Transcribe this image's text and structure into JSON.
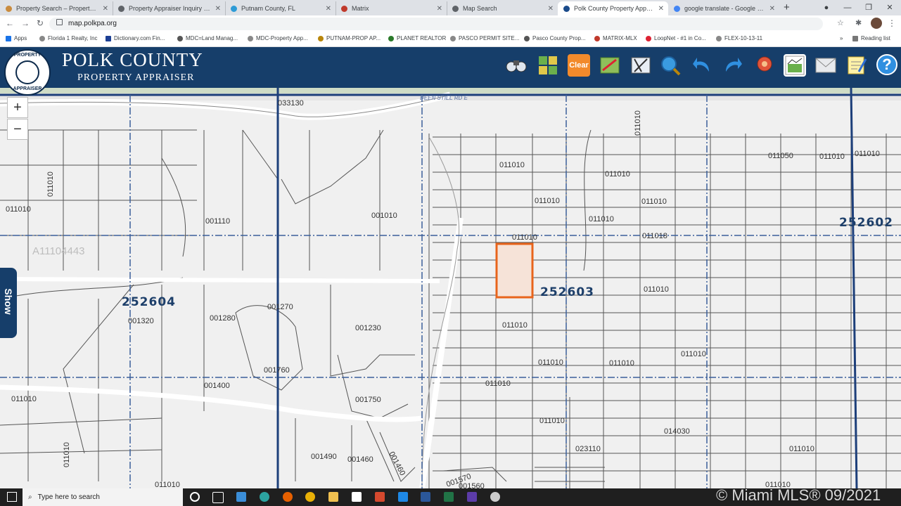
{
  "tabs": [
    {
      "label": "Property Search – Property Appr",
      "color": "#c98b3e"
    },
    {
      "label": "Property Appraiser Inquiry - Put",
      "color": "#5f6368"
    },
    {
      "label": "Putnam County, FL",
      "color": "#2e9bd6"
    },
    {
      "label": "Matrix",
      "color": "#c0392b"
    },
    {
      "label": "Map Search",
      "color": "#5f6368"
    },
    {
      "label": "Polk County Property Appraiser",
      "color": "#1a4a8a"
    },
    {
      "label": "google translate - Google Searc",
      "color": "#4285f4"
    }
  ],
  "new_tab": "+",
  "url": "map.polkpa.org",
  "bookmarks": [
    "Apps",
    "Florida 1 Realty, Inc",
    "Dictionary.com  Fin...",
    "MDC=Land Manag...",
    "MDC-Property App...",
    "PUTNAM-PROP AP...",
    "PLANET REALTOR",
    "PASCO PERMIT SITE...",
    "Pasco County Prop...",
    "MATRIX-MLX",
    "LoopNet - #1 in Co...",
    "FLEX-10-13-11"
  ],
  "reading_list": "Reading list",
  "header": {
    "title": "POLK COUNTY",
    "subtitle": "PROPERTY APPRAISER",
    "logo_top": "PROPERTY",
    "logo_bottom": "APPRAISER"
  },
  "toolbar": [
    "binoculars-icon",
    "layers-icon",
    "clear-button",
    "measure-icon",
    "draw-icon",
    "search-globe-icon",
    "undo-icon",
    "redo-icon",
    "pin-icon",
    "chart-icon",
    "mail-icon",
    "notes-icon",
    "help-icon"
  ],
  "clear_label": "Clear",
  "help_label": "?",
  "zoom": {
    "in": "+",
    "out": "−"
  },
  "show_label": "Show",
  "mls_ref": "A11104443",
  "road": "DEEN STILL RD E",
  "sections": [
    "252602",
    "252603",
    "252604"
  ],
  "parcels": [
    "033130",
    "011010",
    "011010",
    "011050",
    "011010",
    "011010",
    "011010",
    "011010",
    "011010",
    "011010",
    "001110",
    "001010",
    "011010",
    "011018",
    "011010",
    "001320",
    "001280",
    "001270",
    "001230",
    "011010",
    "011010",
    "011010",
    "011010",
    "001760",
    "001400",
    "011010",
    "011010",
    "001750",
    "011010",
    "011010",
    "014030",
    "023110",
    "011010",
    "001490",
    "001460",
    "001460",
    "001570",
    "001560",
    "011010",
    "011010"
  ],
  "search_placeholder": "Type here to search",
  "watermark": "© Miami MLS® 09/2021"
}
